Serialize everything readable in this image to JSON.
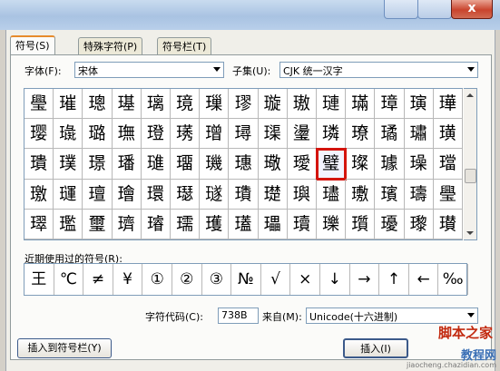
{
  "tabs": [
    {
      "label": "符号(S)",
      "active": true
    },
    {
      "label": "特殊字符(P)",
      "active": false
    },
    {
      "label": "符号栏(T)",
      "active": false
    }
  ],
  "font": {
    "label": "字体(F):",
    "value": "宋体"
  },
  "subset": {
    "label": "子集(U):",
    "value": "CJK 统一汉字"
  },
  "grid": [
    [
      "璺",
      "璀",
      "璁",
      "璂",
      "璃",
      "璄",
      "璅",
      "璆",
      "璇",
      "璈",
      "璉",
      "璊",
      "璋",
      "璌",
      "璍"
    ],
    [
      "璎",
      "璏",
      "璐",
      "璑",
      "璒",
      "璓",
      "璔",
      "璕",
      "璖",
      "璗",
      "璘",
      "璙",
      "璚",
      "璛",
      "璜"
    ],
    [
      "璝",
      "璞",
      "璟",
      "璠",
      "璡",
      "璢",
      "璣",
      "璤",
      "璥",
      "璦",
      "璧",
      "璨",
      "璩",
      "璪",
      "璫"
    ],
    [
      "璬",
      "璭",
      "璮",
      "璯",
      "環",
      "璱",
      "璲",
      "璳",
      "璴",
      "璵",
      "璶",
      "璷",
      "璸",
      "璹",
      "璺"
    ],
    [
      "璻",
      "璼",
      "璽",
      "璾",
      "璿",
      "瓀",
      "瓁",
      "瓂",
      "瓃",
      "瓄",
      "瓅",
      "瓆",
      "瓇",
      "瓈",
      "瓉"
    ]
  ],
  "selected": {
    "row": 2,
    "col": 10
  },
  "recent": {
    "label": "近期使用过的符号(R):",
    "symbols": [
      "王",
      "℃",
      "≠",
      "¥",
      "①",
      "②",
      "③",
      "№",
      "√",
      "×",
      "↓",
      "→",
      "↑",
      "←",
      "‰"
    ]
  },
  "char_code": {
    "label": "字符代码(C):",
    "value": "738B"
  },
  "from": {
    "label": "来自(M):",
    "value": "Unicode(十六进制)"
  },
  "buttons": {
    "insert_to_bar": "插入到符号栏(Y)",
    "insert": "插入(I)"
  },
  "close_glyph": "x",
  "watermark": {
    "line1": "脚本之家",
    "line2": "教程网",
    "line3": "jiaocheng.chazidian.com"
  }
}
